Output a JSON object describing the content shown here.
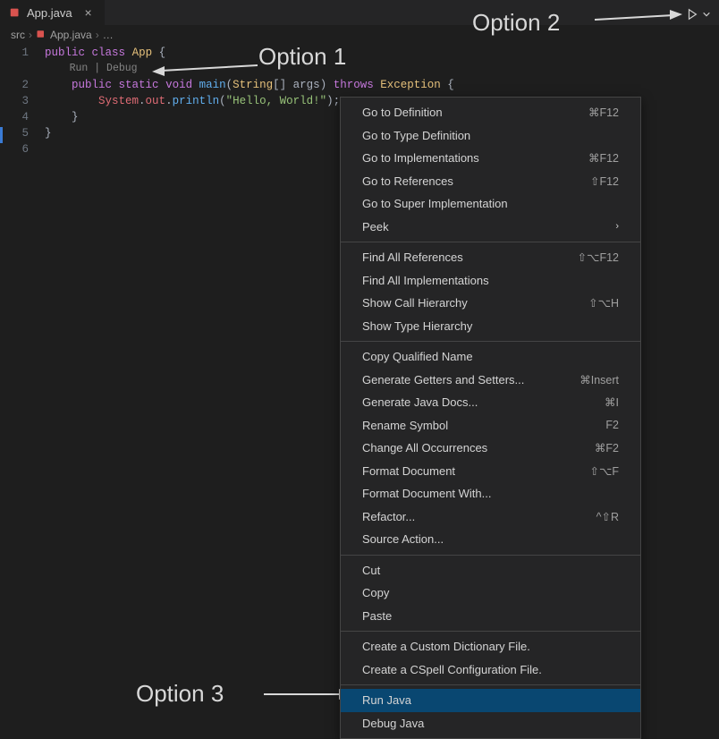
{
  "tab": {
    "filename": "App.java"
  },
  "breadcrumb": {
    "seg1": "src",
    "seg2": "App.java",
    "seg3": "…"
  },
  "codelens": {
    "run": "Run",
    "debug": "Debug",
    "sep": " | "
  },
  "code": {
    "lines": [
      "1",
      "2",
      "3",
      "4",
      "5",
      "6"
    ],
    "l1": {
      "p1": "public",
      "p2": "class",
      "p3": "App",
      "p4": "{"
    },
    "l2": {
      "p1": "public",
      "p2": "static",
      "p3": "void",
      "p4": "main",
      "p5": "(",
      "p6": "String",
      "p7": "[]",
      "p8": " args",
      "p9": ")",
      "p10": "throws",
      "p11": "Exception",
      "p12": "{"
    },
    "l3": {
      "p1": "System",
      "p2": ".",
      "p3": "out",
      "p4": ".",
      "p5": "println",
      "p6": "(",
      "p7": "\"Hello, World!\"",
      "p8": ")",
      "p9": ";"
    },
    "l4": {
      "p1": "}"
    },
    "l5": {
      "p1": "}"
    }
  },
  "menu": {
    "goto_def": "Go to Definition",
    "goto_def_sc": "⌘F12",
    "goto_type": "Go to Type Definition",
    "goto_impl": "Go to Implementations",
    "goto_impl_sc": "⌘F12",
    "goto_refs": "Go to References",
    "goto_refs_sc": "⇧F12",
    "goto_super": "Go to Super Implementation",
    "peek": "Peek",
    "find_all_refs": "Find All References",
    "find_all_refs_sc": "⇧⌥F12",
    "find_all_impl": "Find All Implementations",
    "show_call": "Show Call Hierarchy",
    "show_call_sc": "⇧⌥H",
    "show_type": "Show Type Hierarchy",
    "copy_qual": "Copy Qualified Name",
    "gen_getset": "Generate Getters and Setters...",
    "gen_getset_sc": "⌘Insert",
    "gen_docs": "Generate Java Docs...",
    "gen_docs_sc": "⌘I",
    "rename": "Rename Symbol",
    "rename_sc": "F2",
    "change_occ": "Change All Occurrences",
    "change_occ_sc": "⌘F2",
    "fmt_doc": "Format Document",
    "fmt_doc_sc": "⇧⌥F",
    "fmt_with": "Format Document With...",
    "refactor": "Refactor...",
    "refactor_sc": "^⇧R",
    "source_act": "Source Action...",
    "cut": "Cut",
    "copy": "Copy",
    "paste": "Paste",
    "cust_dict": "Create a Custom Dictionary File.",
    "cspell": "Create a CSpell Configuration File.",
    "run_java": "Run Java",
    "debug_java": "Debug Java"
  },
  "annotations": {
    "opt1": "Option 1",
    "opt2": "Option 2",
    "opt3": "Option 3"
  },
  "colors": {
    "java_icon": "#d9534f"
  }
}
